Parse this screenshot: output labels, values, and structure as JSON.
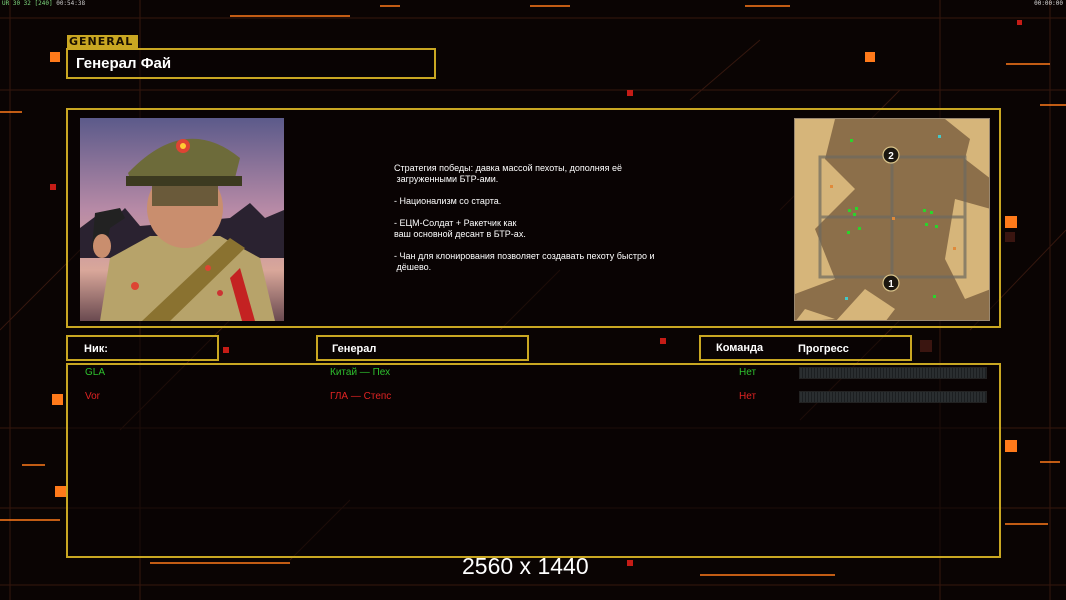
{
  "hud": {
    "top_left": "UR 30 32 [240]",
    "time_left": "00:54:38",
    "time_right": "00:00:00"
  },
  "general": {
    "tag": "GENERAL",
    "name": "Генерал Фай",
    "portrait_icon": "general-fai-portrait",
    "description": "Стратегия победы: давка массой пехоты, дополняя её\n загруженными БТР-ами.\n\n- Национализм со старта.\n\n- ЕЦМ-Солдат + Ракетчик как\nваш основной десант в БТР-ах.\n\n- Чан для клонирования позволяет создавать пехоту быстро и\n дёшево."
  },
  "minimap": {
    "icon": "map-preview",
    "spawn_markers": [
      "2",
      "1"
    ]
  },
  "table": {
    "headers": {
      "nick": "Ник:",
      "general": "Генерал",
      "team": "Команда",
      "progress": "Прогресс"
    },
    "rows": [
      {
        "nick": "GLA",
        "general": "Китай — Пех",
        "team": "Нет",
        "progress": 0,
        "color": "#2ec02e"
      },
      {
        "nick": "Vor",
        "general": "ГЛА — Степс",
        "team": "Нет",
        "progress": 0,
        "color": "#e02323"
      }
    ]
  },
  "overlay": {
    "resolution": "2560 x 1440"
  },
  "colors": {
    "frame": "#c9a722",
    "accent": "#ff7a1a",
    "background": "#0a0403"
  }
}
